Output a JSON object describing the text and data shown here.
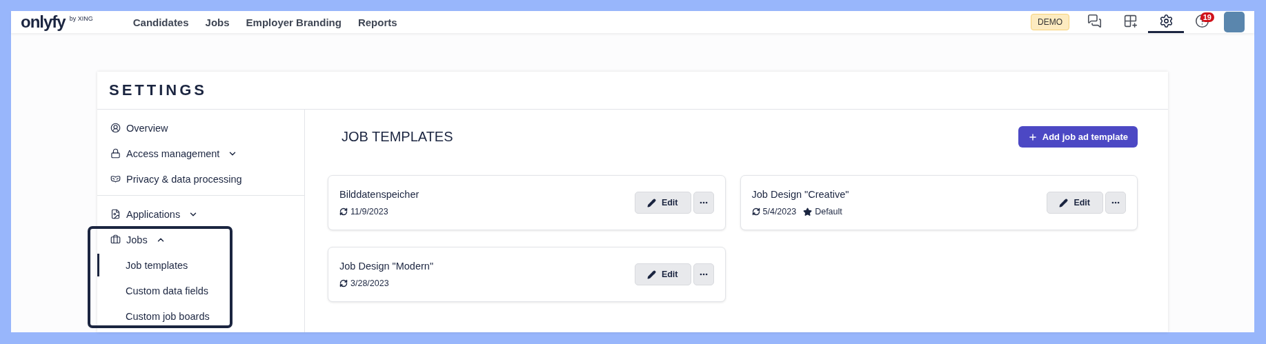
{
  "brand": {
    "logo": "onlyfy",
    "byline": "by XING"
  },
  "nav": [
    {
      "label": "Candidates"
    },
    {
      "label": "Jobs"
    },
    {
      "label": "Employer Branding"
    },
    {
      "label": "Reports"
    }
  ],
  "toolbar": {
    "badge": "DEMO",
    "notifications": "19",
    "tools": [
      {
        "selected": false
      },
      {
        "selected": false
      },
      {
        "selected": true
      },
      {
        "selected": false
      }
    ]
  },
  "settings": {
    "title": "SETTINGS",
    "sidebar": [
      {
        "items": [
          {
            "label": "Overview"
          },
          {
            "label": "Access management",
            "expanded": false
          },
          {
            "label": "Privacy & data processing"
          }
        ]
      },
      {
        "items": [
          {
            "label": "Applications",
            "expanded": false
          },
          {
            "label": "Jobs",
            "expanded": true,
            "highlighted": true,
            "children": [
              {
                "label": "Job templates",
                "selected": true
              },
              {
                "label": "Custom data fields",
                "selected": false
              },
              {
                "label": "Custom job boards",
                "selected": false
              }
            ]
          }
        ]
      }
    ],
    "content": {
      "heading": "JOB TEMPLATES",
      "add_button": "Add job ad template",
      "templates": [
        {
          "name": "Bilddatenspeicher",
          "date": "11/9/2023",
          "default": false,
          "edit": "Edit"
        },
        {
          "name": "Job Design \"Creative\"",
          "date": "5/4/2023",
          "default": true,
          "default_label": "Default",
          "edit": "Edit"
        },
        {
          "name": "Job Design \"Modern\"",
          "date": "3/28/2023",
          "default": false,
          "edit": "Edit"
        }
      ]
    }
  }
}
